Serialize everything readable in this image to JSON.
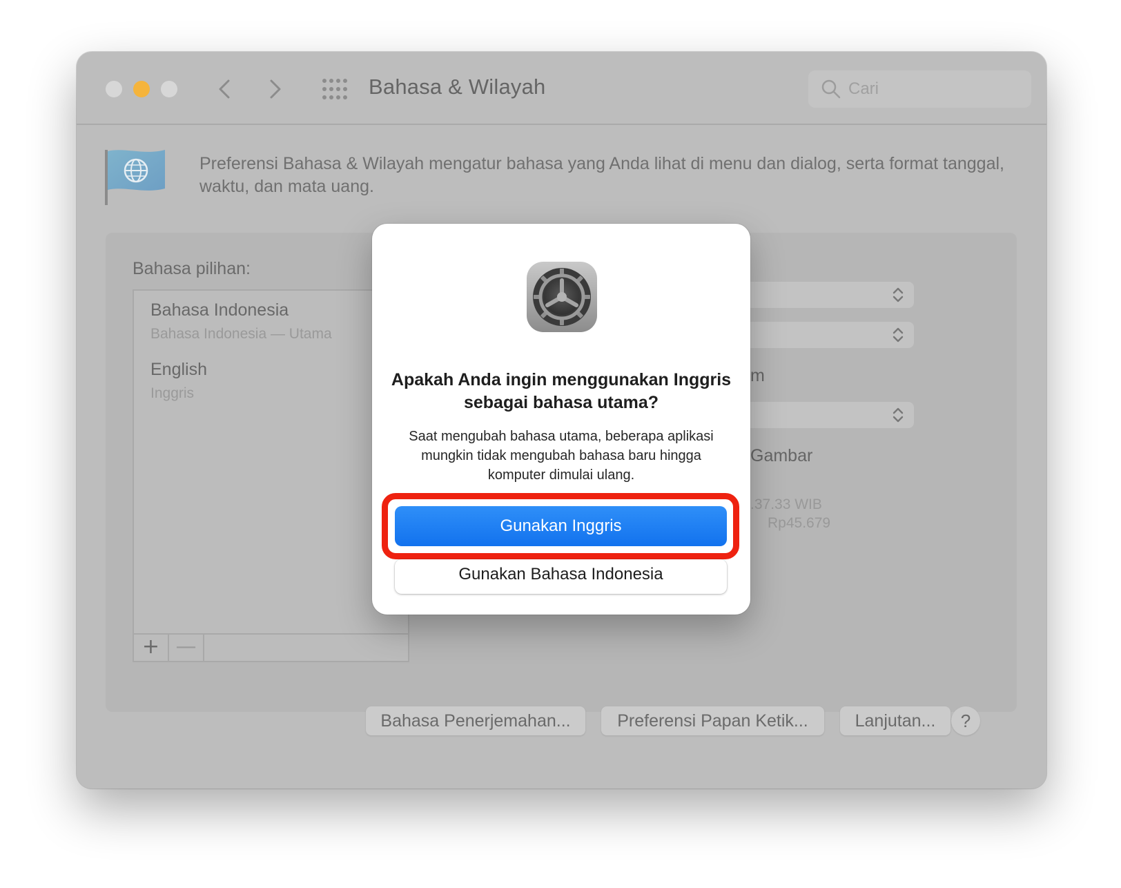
{
  "window": {
    "title": "Bahasa & Wilayah",
    "search_placeholder": "Cari",
    "description": "Preferensi Bahasa & Wilayah mengatur bahasa yang Anda lihat di menu dan dialog, serta format tanggal, waktu, dan mata uang."
  },
  "languages": {
    "label": "Bahasa pilihan:",
    "items": [
      {
        "name": "Bahasa Indonesia",
        "subtitle": "Bahasa Indonesia — Utama"
      },
      {
        "name": "English",
        "subtitle": "Inggris"
      }
    ],
    "add": "+",
    "remove": "—"
  },
  "right_fragments": {
    "frag1": "m",
    "frag2": "Gambar",
    "time_sample": ".37.33 WIB",
    "currency_sample": "Rp45.679"
  },
  "bottom_buttons": {
    "translation": "Bahasa Penerjemahan...",
    "keyboard": "Preferensi Papan Ketik...",
    "advanced": "Lanjutan...",
    "help": "?"
  },
  "dialog": {
    "title": "Apakah Anda ingin menggunakan Inggris sebagai bahasa utama?",
    "message": "Saat mengubah bahasa utama, beberapa aplikasi mungkin tidak mengubah bahasa baru hingga komputer dimulai ulang.",
    "primary_button": "Gunakan Inggris",
    "secondary_button": "Gunakan Bahasa Indonesia"
  },
  "colors": {
    "accent": "#1a7ff3",
    "highlight": "#ee2210",
    "minimize": "#f5b43c"
  },
  "icons": {
    "flag": "flag-globe-icon",
    "dialog": "system-preferences-gear-icon"
  }
}
